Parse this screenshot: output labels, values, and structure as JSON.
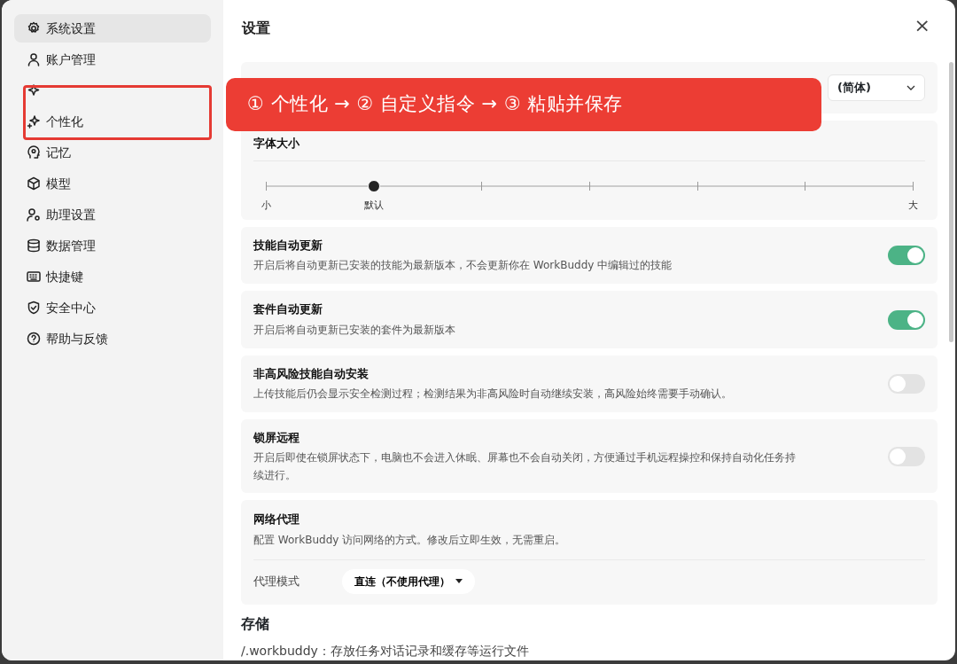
{
  "sidebar": {
    "items": [
      {
        "label": "系统设置",
        "selected": true
      },
      {
        "label": "账户管理",
        "selected": false
      },
      {
        "selected": false
      },
      {
        "label": "个性化",
        "selected": false
      },
      {
        "label": "记忆",
        "selected": false
      },
      {
        "label": "模型",
        "selected": false
      },
      {
        "label": "助理设置",
        "selected": false
      },
      {
        "label": "数据管理",
        "selected": false
      },
      {
        "label": "快捷键",
        "selected": false
      },
      {
        "label": "安全中心",
        "selected": false
      },
      {
        "label": "帮助与反馈",
        "selected": false
      }
    ]
  },
  "header": {
    "title": "设置",
    "close": "×"
  },
  "settings": [
    {
      "kind": "select",
      "value": "(简体)"
    },
    {
      "kind": "slider",
      "title": "字体大小",
      "level": 0.1667,
      "labels": [
        "小",
        "默认",
        "大"
      ]
    },
    {
      "kind": "toggle",
      "title": "技能自动更新",
      "description": "开启后将自动更新已安装的技能为最新版本，不会更新你在 WorkBuddy 中编辑过的技能",
      "on": true
    },
    {
      "kind": "toggle",
      "title": "套件自动更新",
      "description": "开启后将自动更新已安装的套件为最新版本",
      "on": true
    },
    {
      "kind": "toggle",
      "title": "非高风险技能自动安装",
      "description": "上传技能后仍会显示安全检测过程；检测结果为非高风险时自动继续安装，高风险始终需要手动确认。",
      "on": false
    },
    {
      "kind": "toggle",
      "title": "锁屏远程",
      "description": "开启后即使在锁屏状态下，电脑也不会进入休眠、屏幕也不会自动关闭，方便通过手机远程操控和保持自动化任务持续进行。",
      "on": false
    },
    {
      "kind": "proxy",
      "title": "网络代理",
      "description": "配置 WorkBuddy 访问网络的方式。修改后立即生效，无需重启。",
      "field_label": "代理模式",
      "value": "直连（不使用代理）"
    }
  ],
  "storage": {
    "title": "存储",
    "text": "/.workbuddy：存放任务对话记录和缓存等运行文件"
  },
  "annotation": {
    "banner": "① 个性化 → ② 自定义指令 → ③ 粘贴并保存"
  }
}
